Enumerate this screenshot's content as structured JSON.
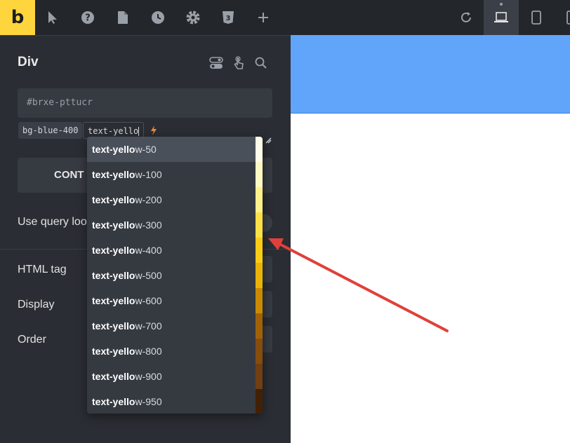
{
  "toolbar": {
    "logo": "b",
    "icons": [
      "cursor-icon",
      "help-icon",
      "page-icon",
      "history-icon",
      "settings-icon",
      "css3-icon",
      "plus-icon",
      "reload-icon",
      "laptop-icon",
      "tablet-icon",
      "mobile-icon"
    ],
    "active_device": "laptop"
  },
  "panel": {
    "title": "Div",
    "selector_placeholder": "#brxe-pttucr",
    "classes": [
      "bg-blue-400"
    ],
    "class_input_value": "text-yello",
    "content_button": "CONT",
    "query_loop_label": "Use query loo",
    "rows": [
      {
        "label": "HTML tag"
      },
      {
        "label": "Display"
      },
      {
        "label": "Order"
      }
    ]
  },
  "autocomplete": {
    "query": "text-yello",
    "options": [
      {
        "match": "text-yello",
        "rest": "w-50",
        "color": "#fefce8",
        "highlighted": true
      },
      {
        "match": "text-yello",
        "rest": "w-100",
        "color": "#fef9c3"
      },
      {
        "match": "text-yello",
        "rest": "w-200",
        "color": "#fef08a"
      },
      {
        "match": "text-yello",
        "rest": "w-300",
        "color": "#fde047"
      },
      {
        "match": "text-yello",
        "rest": "w-400",
        "color": "#facc15"
      },
      {
        "match": "text-yello",
        "rest": "w-500",
        "color": "#eab308"
      },
      {
        "match": "text-yello",
        "rest": "w-600",
        "color": "#ca8a04"
      },
      {
        "match": "text-yello",
        "rest": "w-700",
        "color": "#a16207"
      },
      {
        "match": "text-yello",
        "rest": "w-800",
        "color": "#854d0e"
      },
      {
        "match": "text-yello",
        "rest": "w-900",
        "color": "#713f12"
      },
      {
        "match": "text-yello",
        "rest": "w-950",
        "color": "#422006"
      }
    ]
  },
  "colors": {
    "logo_bg": "#ffd53e",
    "toolbar_bg": "#23262b",
    "panel_bg": "#2a2d33",
    "canvas_section": "#60a5fa",
    "annotation_arrow": "#e0403a"
  }
}
